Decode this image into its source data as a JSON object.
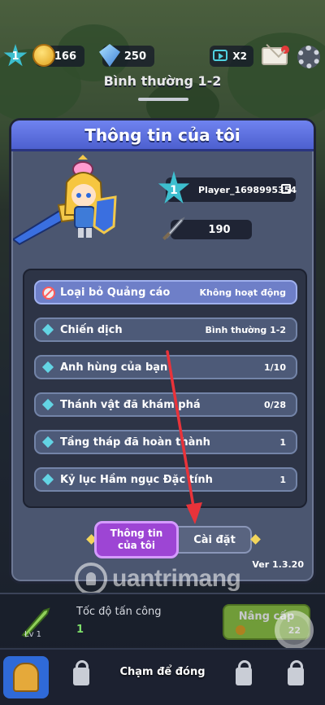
{
  "hud": {
    "level": "1",
    "coins": "166",
    "gems": "250",
    "speed_multiplier": "X2"
  },
  "stage": {
    "title": "Bình thường 1-2"
  },
  "modal": {
    "title": "Thông tin của tôi",
    "player": {
      "level": "1",
      "name": "Player_1698995354"
    },
    "power": "190",
    "stats": [
      {
        "label": "Loại bỏ Quảng cáo",
        "value": "Không hoạt động",
        "icon": "no-ads-icon"
      },
      {
        "label": "Chiến dịch",
        "value": "Bình thường 1-2",
        "icon": "diamond-icon"
      },
      {
        "label": "Anh hùng của bạn",
        "value": "1/10",
        "icon": "diamond-icon"
      },
      {
        "label": "Thánh vật đã khám phá",
        "value": "0/28",
        "icon": "diamond-icon"
      },
      {
        "label": "Tầng tháp đã hoàn thành",
        "value": "1",
        "icon": "diamond-icon"
      },
      {
        "label": "Kỷ lục Hầm ngục Đặc tính",
        "value": "1",
        "icon": "diamond-icon"
      }
    ],
    "tabs": {
      "active": "Thông tin\ncủa tôi",
      "inactive": "Cài đặt"
    },
    "version": "Ver 1.3.20"
  },
  "upgrade": {
    "weapon_level": "Lv 1",
    "attack_label": "Tốc độ tấn công",
    "attack_value": "1",
    "button_label": "Nâng cấp",
    "button_cost": "22"
  },
  "watermark": "uantrimang",
  "close_hint": "Chạm để đóng",
  "colors": {
    "header": "#5a6ddc",
    "accent_cyan": "#3dbfcf",
    "arrow": "#e8333a",
    "active_tab": "#9d45d4"
  }
}
